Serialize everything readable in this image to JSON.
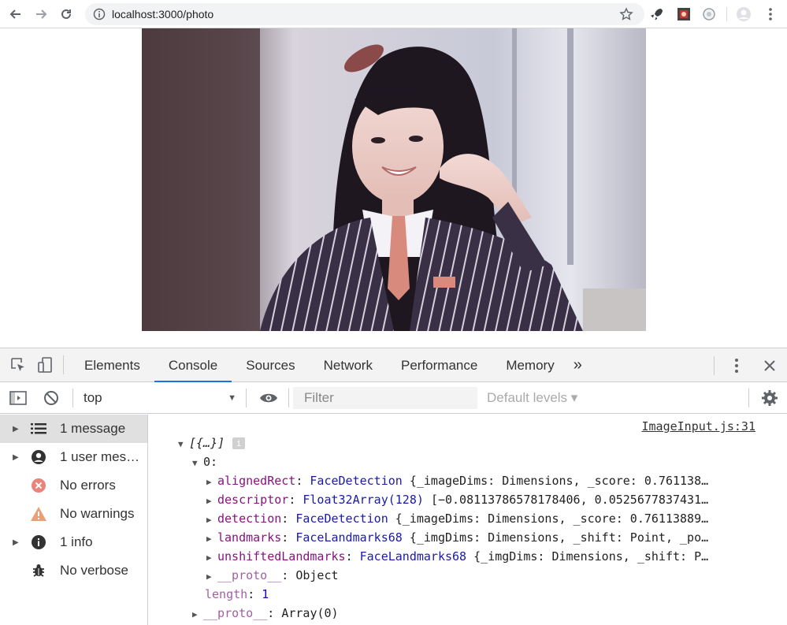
{
  "browser": {
    "url": "localhost:3000/photo"
  },
  "page": {
    "photo_alt": ""
  },
  "devtools": {
    "tabs": [
      "Elements",
      "Console",
      "Sources",
      "Network",
      "Performance",
      "Memory"
    ],
    "more_tabs": "»",
    "context": "top",
    "filter_placeholder": "Filter",
    "levels": "Default levels ▾",
    "sidebar": [
      {
        "label": "1 message",
        "icon": "list-icon"
      },
      {
        "label": "1 user mes…",
        "icon": "user-icon"
      },
      {
        "label": "No errors",
        "icon": "error-icon"
      },
      {
        "label": "No warnings",
        "icon": "warning-icon"
      },
      {
        "label": "1 info",
        "icon": "info-icon"
      },
      {
        "label": "No verbose",
        "icon": "bug-icon"
      }
    ],
    "console": {
      "source": "ImageInput.js:31",
      "root": "[{…}]",
      "badge": "i",
      "index": "0:",
      "props": [
        {
          "key": "alignedRect",
          "type": "FaceDetection",
          "value": "{_imageDims: Dimensions, _score: 0.761138…"
        },
        {
          "key": "descriptor",
          "type": "Float32Array(128)",
          "value": "[−0.08113786578178406, 0.0525677837431…"
        },
        {
          "key": "detection",
          "type": "FaceDetection",
          "value": "{_imageDims: Dimensions, _score: 0.76113889…"
        },
        {
          "key": "landmarks",
          "type": "FaceLandmarks68",
          "value": "{_imgDims: Dimensions, _shift: Point, _po…"
        },
        {
          "key": "unshiftedLandmarks",
          "type": "FaceLandmarks68",
          "value": "{_imgDims: Dimensions, _shift: P…"
        },
        {
          "key": "__proto__",
          "type": "",
          "value": "Object"
        }
      ],
      "length_key": "length",
      "length_value": "1",
      "array_proto_key": "__proto__",
      "array_proto_value": "Array(0)"
    }
  }
}
